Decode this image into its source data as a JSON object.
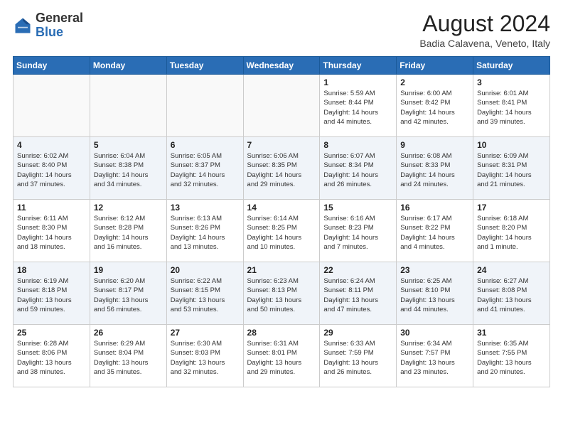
{
  "header": {
    "logo_general": "General",
    "logo_blue": "Blue",
    "title": "August 2024",
    "location": "Badia Calavena, Veneto, Italy"
  },
  "days_of_week": [
    "Sunday",
    "Monday",
    "Tuesday",
    "Wednesday",
    "Thursday",
    "Friday",
    "Saturday"
  ],
  "weeks": [
    [
      {
        "day": "",
        "info": ""
      },
      {
        "day": "",
        "info": ""
      },
      {
        "day": "",
        "info": ""
      },
      {
        "day": "",
        "info": ""
      },
      {
        "day": "1",
        "info": "Sunrise: 5:59 AM\nSunset: 8:44 PM\nDaylight: 14 hours\nand 44 minutes."
      },
      {
        "day": "2",
        "info": "Sunrise: 6:00 AM\nSunset: 8:42 PM\nDaylight: 14 hours\nand 42 minutes."
      },
      {
        "day": "3",
        "info": "Sunrise: 6:01 AM\nSunset: 8:41 PM\nDaylight: 14 hours\nand 39 minutes."
      }
    ],
    [
      {
        "day": "4",
        "info": "Sunrise: 6:02 AM\nSunset: 8:40 PM\nDaylight: 14 hours\nand 37 minutes."
      },
      {
        "day": "5",
        "info": "Sunrise: 6:04 AM\nSunset: 8:38 PM\nDaylight: 14 hours\nand 34 minutes."
      },
      {
        "day": "6",
        "info": "Sunrise: 6:05 AM\nSunset: 8:37 PM\nDaylight: 14 hours\nand 32 minutes."
      },
      {
        "day": "7",
        "info": "Sunrise: 6:06 AM\nSunset: 8:35 PM\nDaylight: 14 hours\nand 29 minutes."
      },
      {
        "day": "8",
        "info": "Sunrise: 6:07 AM\nSunset: 8:34 PM\nDaylight: 14 hours\nand 26 minutes."
      },
      {
        "day": "9",
        "info": "Sunrise: 6:08 AM\nSunset: 8:33 PM\nDaylight: 14 hours\nand 24 minutes."
      },
      {
        "day": "10",
        "info": "Sunrise: 6:09 AM\nSunset: 8:31 PM\nDaylight: 14 hours\nand 21 minutes."
      }
    ],
    [
      {
        "day": "11",
        "info": "Sunrise: 6:11 AM\nSunset: 8:30 PM\nDaylight: 14 hours\nand 18 minutes."
      },
      {
        "day": "12",
        "info": "Sunrise: 6:12 AM\nSunset: 8:28 PM\nDaylight: 14 hours\nand 16 minutes."
      },
      {
        "day": "13",
        "info": "Sunrise: 6:13 AM\nSunset: 8:26 PM\nDaylight: 14 hours\nand 13 minutes."
      },
      {
        "day": "14",
        "info": "Sunrise: 6:14 AM\nSunset: 8:25 PM\nDaylight: 14 hours\nand 10 minutes."
      },
      {
        "day": "15",
        "info": "Sunrise: 6:16 AM\nSunset: 8:23 PM\nDaylight: 14 hours\nand 7 minutes."
      },
      {
        "day": "16",
        "info": "Sunrise: 6:17 AM\nSunset: 8:22 PM\nDaylight: 14 hours\nand 4 minutes."
      },
      {
        "day": "17",
        "info": "Sunrise: 6:18 AM\nSunset: 8:20 PM\nDaylight: 14 hours\nand 1 minute."
      }
    ],
    [
      {
        "day": "18",
        "info": "Sunrise: 6:19 AM\nSunset: 8:18 PM\nDaylight: 13 hours\nand 59 minutes."
      },
      {
        "day": "19",
        "info": "Sunrise: 6:20 AM\nSunset: 8:17 PM\nDaylight: 13 hours\nand 56 minutes."
      },
      {
        "day": "20",
        "info": "Sunrise: 6:22 AM\nSunset: 8:15 PM\nDaylight: 13 hours\nand 53 minutes."
      },
      {
        "day": "21",
        "info": "Sunrise: 6:23 AM\nSunset: 8:13 PM\nDaylight: 13 hours\nand 50 minutes."
      },
      {
        "day": "22",
        "info": "Sunrise: 6:24 AM\nSunset: 8:11 PM\nDaylight: 13 hours\nand 47 minutes."
      },
      {
        "day": "23",
        "info": "Sunrise: 6:25 AM\nSunset: 8:10 PM\nDaylight: 13 hours\nand 44 minutes."
      },
      {
        "day": "24",
        "info": "Sunrise: 6:27 AM\nSunset: 8:08 PM\nDaylight: 13 hours\nand 41 minutes."
      }
    ],
    [
      {
        "day": "25",
        "info": "Sunrise: 6:28 AM\nSunset: 8:06 PM\nDaylight: 13 hours\nand 38 minutes."
      },
      {
        "day": "26",
        "info": "Sunrise: 6:29 AM\nSunset: 8:04 PM\nDaylight: 13 hours\nand 35 minutes."
      },
      {
        "day": "27",
        "info": "Sunrise: 6:30 AM\nSunset: 8:03 PM\nDaylight: 13 hours\nand 32 minutes."
      },
      {
        "day": "28",
        "info": "Sunrise: 6:31 AM\nSunset: 8:01 PM\nDaylight: 13 hours\nand 29 minutes."
      },
      {
        "day": "29",
        "info": "Sunrise: 6:33 AM\nSunset: 7:59 PM\nDaylight: 13 hours\nand 26 minutes."
      },
      {
        "day": "30",
        "info": "Sunrise: 6:34 AM\nSunset: 7:57 PM\nDaylight: 13 hours\nand 23 minutes."
      },
      {
        "day": "31",
        "info": "Sunrise: 6:35 AM\nSunset: 7:55 PM\nDaylight: 13 hours\nand 20 minutes."
      }
    ]
  ]
}
